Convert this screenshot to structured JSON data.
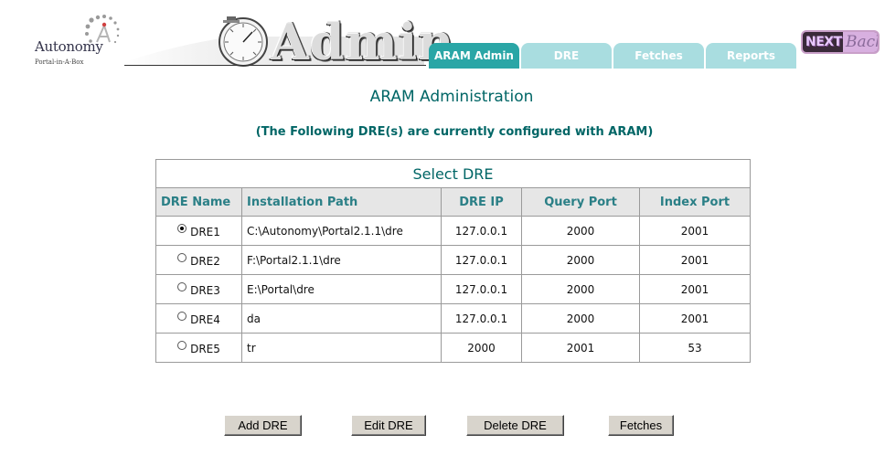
{
  "logo": {
    "name": "Autonomy",
    "tagline": "Portal-in-A-Box"
  },
  "banner": {
    "text": "Admin"
  },
  "tabs": [
    {
      "label": "ARAM Admin",
      "active": true
    },
    {
      "label": "DRE",
      "active": false
    },
    {
      "label": "Fetches",
      "active": false
    },
    {
      "label": "Reports",
      "active": false
    }
  ],
  "nextback": {
    "next": "NEXT",
    "back": "Back"
  },
  "page": {
    "title": "ARAM Administration",
    "subtitle": "(The Following DRE(s) are currently configured with ARAM)"
  },
  "table": {
    "caption": "Select DRE",
    "columns": [
      "DRE Name",
      "Installation Path",
      "DRE IP",
      "Query Port",
      "Index Port"
    ],
    "rows": [
      {
        "name": "DRE1",
        "path": "C:\\Autonomy\\Portal2.1.1\\dre",
        "ip": "127.0.0.1",
        "query_port": "2000",
        "index_port": "2001",
        "selected": true
      },
      {
        "name": "DRE2",
        "path": "F:\\Portal2.1.1\\dre",
        "ip": "127.0.0.1",
        "query_port": "2000",
        "index_port": "2001",
        "selected": false
      },
      {
        "name": "DRE3",
        "path": "E:\\Portal\\dre",
        "ip": "127.0.0.1",
        "query_port": "2000",
        "index_port": "2001",
        "selected": false
      },
      {
        "name": "DRE4",
        "path": "da",
        "ip": "127.0.0.1",
        "query_port": "2000",
        "index_port": "2001",
        "selected": false
      },
      {
        "name": "DRE5",
        "path": "tr",
        "ip": "2000",
        "query_port": "2001",
        "index_port": "53",
        "selected": false
      }
    ]
  },
  "buttons": {
    "add": "Add DRE",
    "edit": "Edit DRE",
    "delete": "Delete DRE",
    "fetches": "Fetches"
  },
  "colors": {
    "accent": "#006666",
    "tab_active": "#2aa6a6",
    "tab_inactive": "#a9dde0",
    "header_text": "#2a7f86"
  }
}
